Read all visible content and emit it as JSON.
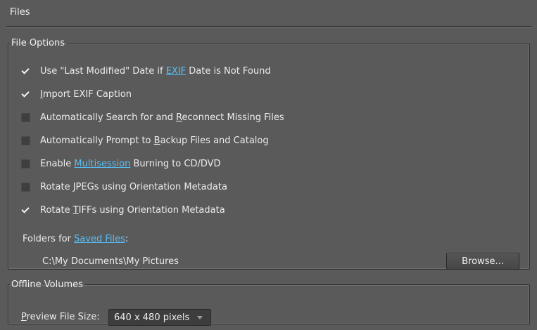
{
  "panel": {
    "title": "Files"
  },
  "file_options": {
    "legend": "File Options",
    "items": [
      {
        "checked": true,
        "parts": [
          "Use \"Last Modified\" Date if ",
          "EXIF",
          " Date is Not Found"
        ]
      },
      {
        "checked": true,
        "parts": [
          "",
          "I",
          "mport EXIF Caption"
        ]
      },
      {
        "checked": false,
        "parts": [
          "Automatically Search for and ",
          "R",
          "econnect Missing Files"
        ]
      },
      {
        "checked": false,
        "parts": [
          "Automatically Prompt to ",
          "B",
          "ackup Files and Catalog"
        ]
      },
      {
        "checked": false,
        "parts": [
          "Enable ",
          "Multisession",
          " Burning to CD/DVD"
        ]
      },
      {
        "checked": false,
        "parts": [
          "Rotate ",
          "J",
          "PEGs using Orientation Metadata"
        ]
      },
      {
        "checked": true,
        "parts": [
          "Rotate ",
          "T",
          "IFFs using Orientation Metadata"
        ]
      }
    ],
    "folders_label": {
      "prefix": "Folders for ",
      "link": "Saved Files",
      "suffix": ":"
    },
    "folder_path": "C:\\My Documents\\My Pictures",
    "browse_label": "Browse..."
  },
  "offline_volumes": {
    "legend": "Offline Volumes",
    "preview_label": {
      "accel": "P",
      "rest": "review File Size:"
    },
    "preview_size_value": "640 x 480 pixels"
  }
}
